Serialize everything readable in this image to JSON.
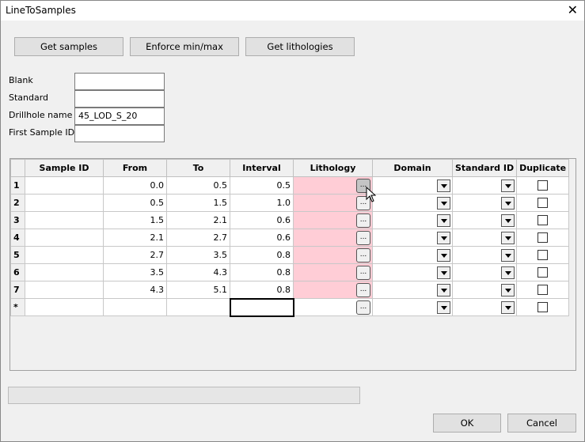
{
  "window": {
    "title": "LineToSamples",
    "close": "✕"
  },
  "toolbar": {
    "get_samples": "Get samples",
    "enforce": "Enforce min/max",
    "get_lithologies": "Get lithologies"
  },
  "fields": [
    {
      "label": "Blank",
      "value": ""
    },
    {
      "label": "Standard",
      "value": ""
    },
    {
      "label": "Drillhole name",
      "value": "45_LOD_S_20"
    },
    {
      "label": "First Sample ID",
      "value": ""
    }
  ],
  "grid": {
    "columns": [
      "Sample ID",
      "From",
      "To",
      "Interval",
      "Lithology",
      "Domain",
      "Standard ID",
      "Duplicate"
    ],
    "rows": [
      {
        "n": "1",
        "id": "",
        "from": "0.0",
        "to": "0.5",
        "interval": "0.5"
      },
      {
        "n": "2",
        "id": "",
        "from": "0.5",
        "to": "1.5",
        "interval": "1.0"
      },
      {
        "n": "3",
        "id": "",
        "from": "1.5",
        "to": "2.1",
        "interval": "0.6"
      },
      {
        "n": "4",
        "id": "",
        "from": "2.1",
        "to": "2.7",
        "interval": "0.6"
      },
      {
        "n": "5",
        "id": "",
        "from": "2.7",
        "to": "3.5",
        "interval": "0.8"
      },
      {
        "n": "6",
        "id": "",
        "from": "3.5",
        "to": "4.3",
        "interval": "0.8"
      },
      {
        "n": "7",
        "id": "",
        "from": "4.3",
        "to": "5.1",
        "interval": "0.8"
      }
    ],
    "new_row_marker": "*",
    "ellipsis": "...",
    "lithology_missing_color": "#ffcdd6"
  },
  "progress": 0,
  "footer": {
    "ok": "OK",
    "cancel": "Cancel"
  }
}
